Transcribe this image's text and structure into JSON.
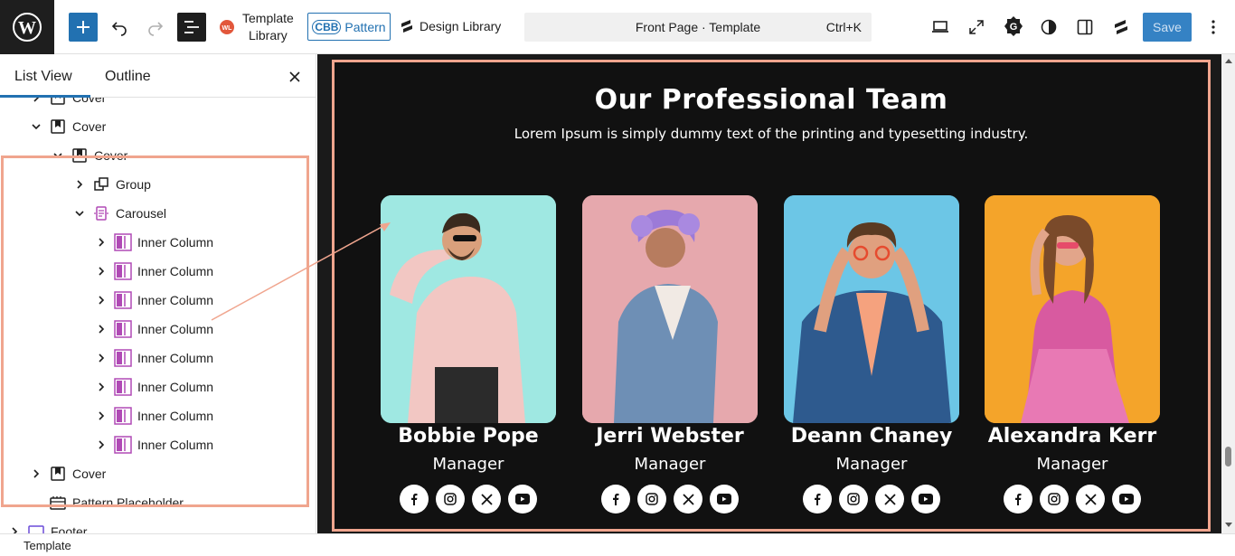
{
  "toolbar": {
    "template_library": "Template Library",
    "template_library_line1": "Template",
    "template_library_line2": "Library",
    "pattern_label": "Pattern",
    "pattern_logo": "CBB",
    "design_library": "Design Library",
    "command_title": "Front Page · Template",
    "command_shortcut": "Ctrl+K",
    "save_label": "Save",
    "accent_color": "#2271b1"
  },
  "sidebar": {
    "tabs": [
      "List View",
      "Outline"
    ],
    "tree": [
      {
        "label": "Cover",
        "level": 1
      },
      {
        "label": "Cover",
        "level": 1
      },
      {
        "label": "Cover",
        "level": 2
      },
      {
        "label": "Group",
        "level": 3
      },
      {
        "label": "Carousel",
        "level": 3
      },
      {
        "label": "Inner Column",
        "level": 4
      },
      {
        "label": "Inner Column",
        "level": 4
      },
      {
        "label": "Inner Column",
        "level": 4
      },
      {
        "label": "Inner Column",
        "level": 4
      },
      {
        "label": "Inner Column",
        "level": 4
      },
      {
        "label": "Inner Column",
        "level": 4
      },
      {
        "label": "Inner Column",
        "level": 4
      },
      {
        "label": "Inner Column",
        "level": 4
      },
      {
        "label": "Cover",
        "level": 1
      },
      {
        "label": "Pattern Placeholder",
        "level": 1
      },
      {
        "label": "Footer",
        "level": 0
      }
    ]
  },
  "status": {
    "breadcrumb": "Template"
  },
  "canvas": {
    "heading": "Our Professional Team",
    "subheading": "Lorem Ipsum is simply dummy text of the printing and typesetting industry.",
    "highlight_color": "#f0a58e",
    "team": [
      {
        "name": "Bobbie Pope",
        "role": "Manager",
        "bg": "#9fe8e2"
      },
      {
        "name": "Jerri Webster",
        "role": "Manager",
        "bg": "#e6a8ad"
      },
      {
        "name": "Deann Chaney",
        "role": "Manager",
        "bg": "#6cc6e6"
      },
      {
        "name": "Alexandra Kerr",
        "role": "Manager",
        "bg": "#f4a42a"
      }
    ],
    "social_icons": [
      "facebook-icon",
      "instagram-icon",
      "x-icon",
      "youtube-icon"
    ]
  }
}
